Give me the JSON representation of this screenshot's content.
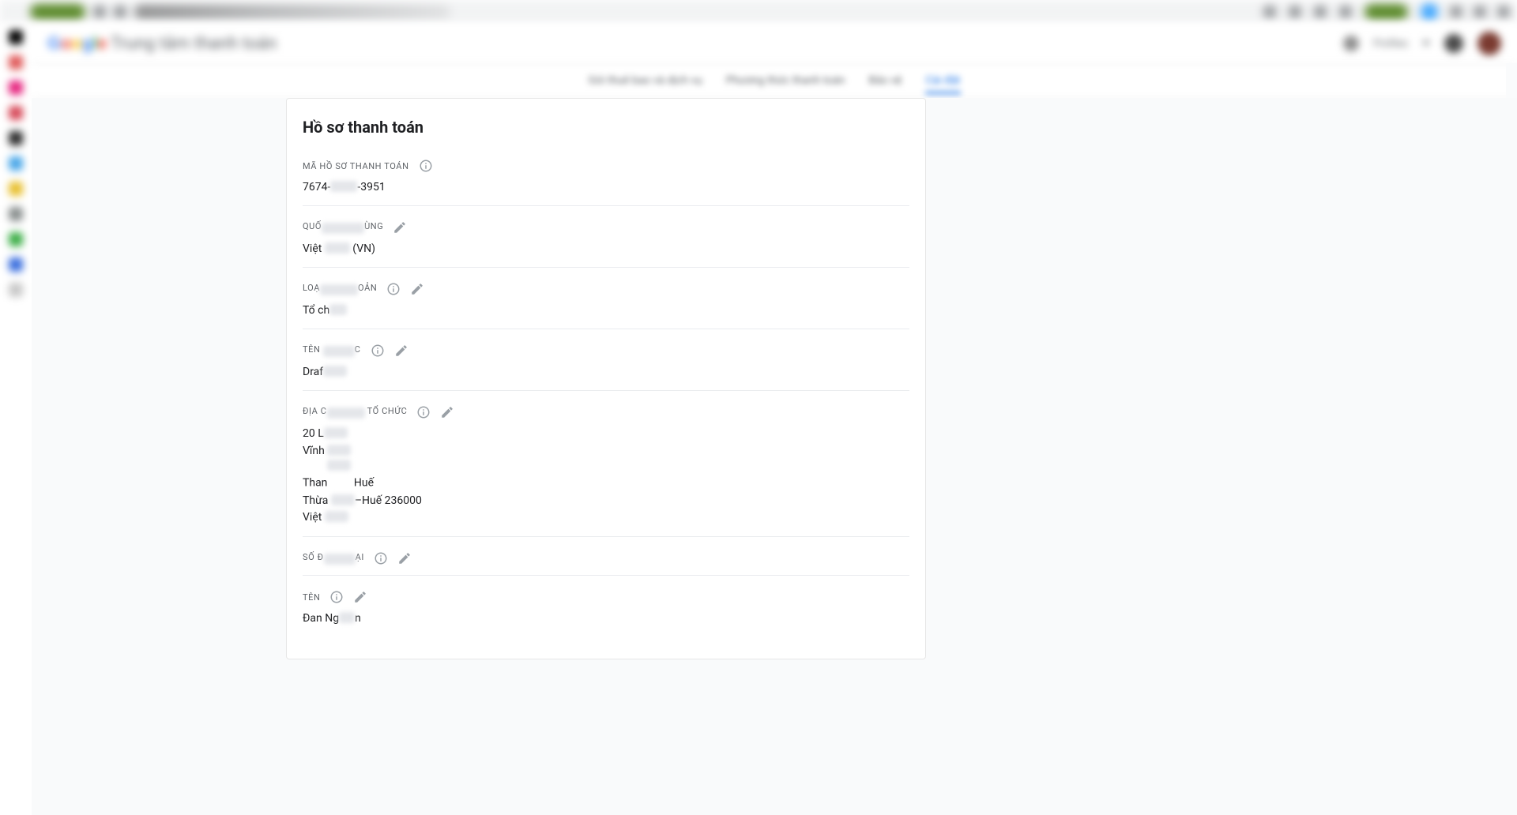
{
  "browser": {
    "url_hint": "pay.google.com/payments/settings"
  },
  "header": {
    "brand": "Google",
    "title": "Trung tâm thanh toán",
    "account_label": "Profiles"
  },
  "tabs": {
    "items": [
      "Gói thuê bao và dịch vụ",
      "Phương thức thanh toán",
      "Bảo vệ",
      "Cài đặt"
    ],
    "active_index": 3
  },
  "card": {
    "title": "Hồ sơ thanh toán",
    "fields": {
      "profile_id": {
        "label": "MÃ HỒ SƠ THANH TOÁN",
        "value_prefix": "7674-",
        "value_suffix": "-3951",
        "has_info": true,
        "has_edit": false
      },
      "country": {
        "label": "QUỐC GIA/VÙNG",
        "value_prefix": "Việt ",
        "value_suffix": " (VN)",
        "has_info": false,
        "has_edit": true
      },
      "account_type": {
        "label": "LOẠI TÀI KHOẢN",
        "value_prefix": "Tổ ch",
        "value_suffix": "",
        "has_info": true,
        "has_edit": true
      },
      "org_name": {
        "label": "TÊN TỔ CHỨC",
        "value_prefix": "Draf",
        "value_suffix": "",
        "has_info": true,
        "has_edit": true
      },
      "org_address": {
        "label": "ĐỊA CHỈ CỦA TỔ CHỨC",
        "lines": [
          {
            "pre": "20 L",
            "post": ""
          },
          {
            "pre": "Vĩnh ",
            "post": ""
          },
          {
            "pre": "Than",
            "post": " Huế"
          },
          {
            "pre": "Thừa ",
            "post": "–Huế 236000"
          },
          {
            "pre": "Việt ",
            "post": ""
          }
        ],
        "has_info": true,
        "has_edit": true
      },
      "phone": {
        "label": "SỐ ĐIỆN THOẠI",
        "value_prefix": "",
        "value_suffix": "",
        "has_info": true,
        "has_edit": true
      },
      "name": {
        "label": "TÊN",
        "value_prefix": "Đan ",
        "value_suffix": "n",
        "mid_visible": "Ng",
        "has_info": true,
        "has_edit": true
      }
    }
  }
}
